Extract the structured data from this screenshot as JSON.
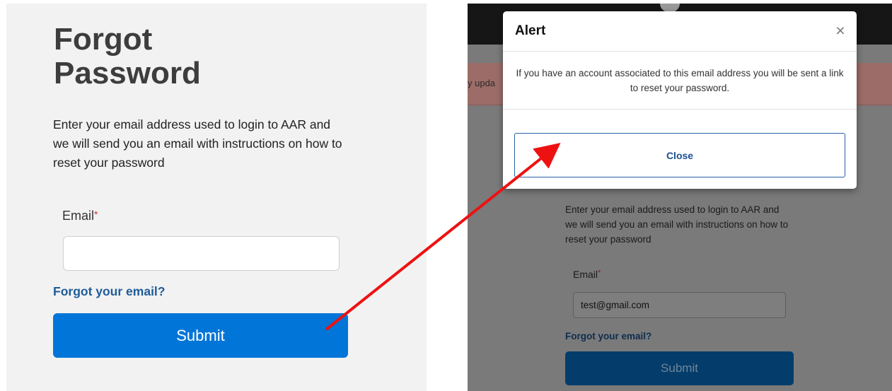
{
  "left": {
    "title": "Forgot Password",
    "description": "Enter your email address used to login to AAR and we will send you an email with instructions on how to reset your password",
    "email_label": "Email",
    "required_mark": "*",
    "email_value": "",
    "forgot_email_link": "Forgot your email?",
    "submit_label": "Submit"
  },
  "right": {
    "banner_fragment": "y upda",
    "description": "Enter your email address used to login to AAR and we will send you an email with instructions on how to reset your password",
    "email_label": "Email",
    "required_mark": "*",
    "email_value": "test@gmail.com",
    "forgot_email_link": "Forgot your email?",
    "submit_label": "Submit"
  },
  "modal": {
    "title": "Alert",
    "close_icon": "close-icon",
    "close_glyph": "×",
    "message": "If you have an account associated to this email address you will be sent a link to reset your password.",
    "close_button_label": "Close"
  },
  "annotation": {
    "arrow_color": "#ee1111"
  },
  "colors": {
    "primary_button": "#0275d8",
    "link": "#1f5c99",
    "required": "#c0392b",
    "alert_banner": "#9c6c68"
  }
}
